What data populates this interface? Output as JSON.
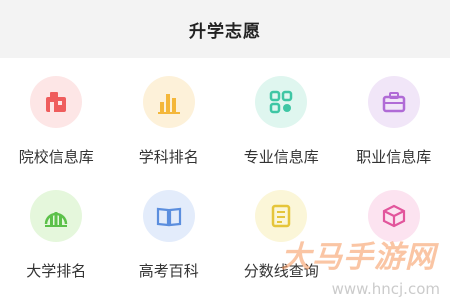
{
  "header": {
    "title": "升学志愿"
  },
  "items": [
    {
      "label": "院校信息库",
      "icon": "school-building-icon",
      "bg": "#fde6e6",
      "color": "#ef5d5d"
    },
    {
      "label": "学科排名",
      "icon": "bar-chart-icon",
      "bg": "#fdf1d9",
      "color": "#f4b73a"
    },
    {
      "label": "专业信息库",
      "icon": "grid-tiles-icon",
      "bg": "#dff6ef",
      "color": "#3ec6a4"
    },
    {
      "label": "职业信息库",
      "icon": "briefcase-icon",
      "bg": "#f1e6f8",
      "color": "#b06bd6"
    },
    {
      "label": "大学排名",
      "icon": "ranking-chart-icon",
      "bg": "#e5f7dc",
      "color": "#5cc14a"
    },
    {
      "label": "高考百科",
      "icon": "open-book-icon",
      "bg": "#e3ecfb",
      "color": "#5b8ede"
    },
    {
      "label": "分数线查询",
      "icon": "document-icon",
      "bg": "#fbf6d8",
      "color": "#e5c53a"
    },
    {
      "label": "",
      "icon": "cube-icon",
      "bg": "#fce3f0",
      "color": "#e2559c"
    }
  ],
  "watermark": {
    "brand": "大马手游网",
    "url": "www.hncj.com"
  }
}
